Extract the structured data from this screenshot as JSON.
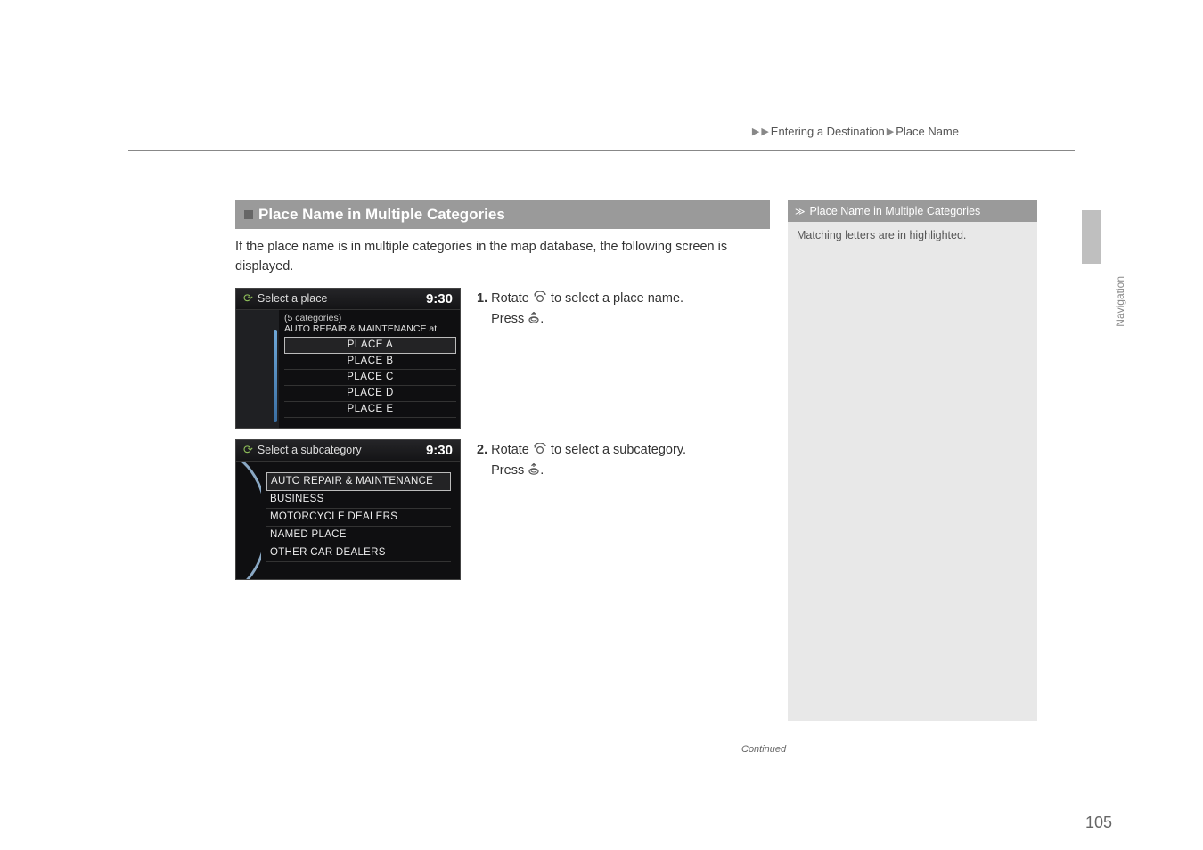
{
  "breadcrumb": {
    "part1": "Entering a Destination",
    "part2": "Place Name"
  },
  "section": {
    "title": "Place Name in Multiple Categories",
    "intro": "If the place name is in multiple categories in the map database, the following screen is displayed."
  },
  "screenshot1": {
    "title": "Select a place",
    "clock": "9:30",
    "countline": "(5 categories)",
    "subtitle": "AUTO REPAIR & MAINTENANCE at",
    "items": [
      "PLACE A",
      "PLACE B",
      "PLACE C",
      "PLACE D",
      "PLACE E"
    ]
  },
  "screenshot2": {
    "title": "Select a subcategory",
    "clock": "9:30",
    "items": [
      "AUTO REPAIR & MAINTENANCE",
      "BUSINESS",
      "MOTORCYCLE DEALERS",
      "NAMED PLACE",
      "OTHER CAR DEALERS"
    ]
  },
  "steps": {
    "s1a": "Rotate",
    "s1b": "to select a place name.",
    "s1c": "Press",
    "s2a": "Rotate",
    "s2b": "to select a subcategory.",
    "s2c": "Press"
  },
  "sidebar": {
    "title": "Place Name in Multiple Categories",
    "body": "Matching letters are in highlighted."
  },
  "footer": {
    "continued": "Continued",
    "navlabel": "Navigation",
    "pagenum": "105"
  }
}
